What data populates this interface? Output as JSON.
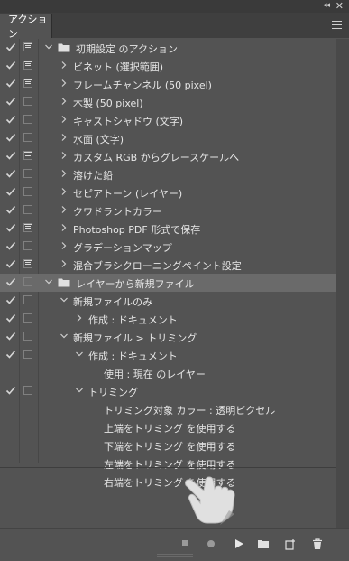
{
  "panel": {
    "tab_label": "アクション"
  },
  "rows": [
    {
      "label": "初期設定 のアクション",
      "check": true,
      "dialog": true,
      "indent": 0,
      "tri": "down",
      "folder": true,
      "sel": false
    },
    {
      "label": "ビネット (選択範囲)",
      "check": true,
      "dialog": true,
      "indent": 1,
      "tri": "right",
      "folder": false,
      "sel": false
    },
    {
      "label": "フレームチャンネル (50 pixel)",
      "check": true,
      "dialog": true,
      "indent": 1,
      "tri": "right",
      "folder": false,
      "sel": false
    },
    {
      "label": "木製 (50 pixel)",
      "check": true,
      "dialog": false,
      "indent": 1,
      "tri": "right",
      "folder": false,
      "sel": false
    },
    {
      "label": "キャストシャドウ (文字)",
      "check": true,
      "dialog": false,
      "indent": 1,
      "tri": "right",
      "folder": false,
      "sel": false
    },
    {
      "label": "水面 (文字)",
      "check": true,
      "dialog": false,
      "indent": 1,
      "tri": "right",
      "folder": false,
      "sel": false
    },
    {
      "label": "カスタム RGB からグレースケールへ",
      "check": true,
      "dialog": true,
      "indent": 1,
      "tri": "right",
      "folder": false,
      "sel": false
    },
    {
      "label": "溶けた鉛",
      "check": true,
      "dialog": false,
      "indent": 1,
      "tri": "right",
      "folder": false,
      "sel": false
    },
    {
      "label": "セピアトーン (レイヤー)",
      "check": true,
      "dialog": false,
      "indent": 1,
      "tri": "right",
      "folder": false,
      "sel": false
    },
    {
      "label": "クワドラントカラー",
      "check": true,
      "dialog": false,
      "indent": 1,
      "tri": "right",
      "folder": false,
      "sel": false
    },
    {
      "label": "Photoshop PDF 形式で保存",
      "check": true,
      "dialog": true,
      "indent": 1,
      "tri": "right",
      "folder": false,
      "sel": false
    },
    {
      "label": "グラデーションマップ",
      "check": true,
      "dialog": false,
      "indent": 1,
      "tri": "right",
      "folder": false,
      "sel": false
    },
    {
      "label": "混合ブラシクローニングペイント設定",
      "check": true,
      "dialog": true,
      "indent": 1,
      "tri": "right",
      "folder": false,
      "sel": false
    },
    {
      "label": "レイヤーから新規ファイル",
      "check": true,
      "dialog": false,
      "indent": 0,
      "tri": "down",
      "folder": true,
      "sel": true
    },
    {
      "label": "新規ファイルのみ",
      "check": true,
      "dialog": false,
      "indent": 1,
      "tri": "down",
      "folder": false,
      "sel": false
    },
    {
      "label": "作成 : ドキュメント",
      "check": true,
      "dialog": false,
      "indent": 2,
      "tri": "right",
      "folder": false,
      "sel": false
    },
    {
      "label": "新規ファイル > トリミング",
      "check": true,
      "dialog": false,
      "indent": 1,
      "tri": "down",
      "folder": false,
      "sel": false
    },
    {
      "label": "作成 : ドキュメント",
      "check": true,
      "dialog": false,
      "indent": 2,
      "tri": "down",
      "folder": false,
      "sel": false
    },
    {
      "label": "使用 : 現在 のレイヤー",
      "check": false,
      "dialog": false,
      "indent": 3,
      "tri": "none",
      "folder": false,
      "sel": false
    },
    {
      "label": "トリミング",
      "check": true,
      "dialog": false,
      "indent": 2,
      "tri": "down",
      "folder": false,
      "sel": false
    },
    {
      "label": "トリミング対象 カラー : 透明ピクセル",
      "check": false,
      "dialog": false,
      "indent": 3,
      "tri": "none",
      "folder": false,
      "sel": false
    },
    {
      "label": "上端をトリミング を使用する",
      "check": false,
      "dialog": false,
      "indent": 3,
      "tri": "none",
      "folder": false,
      "sel": false
    },
    {
      "label": "下端をトリミング を使用する",
      "check": false,
      "dialog": false,
      "indent": 3,
      "tri": "none",
      "folder": false,
      "sel": false
    },
    {
      "label": "左端をトリミング を使用する",
      "check": false,
      "dialog": false,
      "indent": 3,
      "tri": "none",
      "folder": false,
      "sel": false
    },
    {
      "label": "右端をトリミング を使用する",
      "check": false,
      "dialog": false,
      "indent": 3,
      "tri": "none",
      "folder": false,
      "sel": false
    }
  ],
  "toolbar": {
    "icons": [
      "stop-icon",
      "record-icon",
      "play-icon",
      "new-set-folder-icon",
      "new-action-icon",
      "trash-icon"
    ]
  },
  "colors": {
    "panel_bg": "#535353",
    "selected_row": "#6a6a6a",
    "text": "#e6e6e6"
  }
}
